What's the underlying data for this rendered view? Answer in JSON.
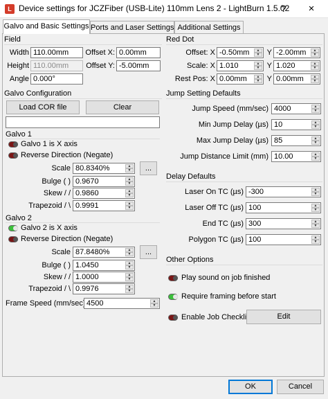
{
  "window": {
    "title": "Device settings for JCZFiber (USB-Lite) 110mm Lens 2 - LightBurn 1.5.02",
    "icon_text": "L",
    "help": "?",
    "close": "×"
  },
  "tabs": [
    "Galvo and Basic Settings",
    "Ports and Laser Settings",
    "Additional Settings"
  ],
  "field": {
    "title": "Field",
    "width_label": "Width",
    "width_value": "110.00mm",
    "height_label": "Height",
    "height_value": "110.00mm",
    "angle_label": "Angle",
    "angle_value": "0.000°",
    "offset_x_label": "Offset X:",
    "offset_x_value": "0.00mm",
    "offset_y_label": "Offset Y:",
    "offset_y_value": "-5.00mm"
  },
  "red_dot": {
    "title": "Red Dot",
    "offset_label": "Offset: X",
    "offset_x": "-0.50mm",
    "offset_y_label": "Y",
    "offset_y": "-2.00mm",
    "scale_label": "Scale: X",
    "scale_x": "1.010",
    "scale_y_label": "Y",
    "scale_y": "1.020",
    "rest_label": "Rest Pos: X",
    "rest_x": "0.00mm",
    "rest_y_label": "Y",
    "rest_y": "0.00mm"
  },
  "galvo_config": {
    "title": "Galvo Configuration",
    "load_cor": "Load COR file",
    "clear": "Clear",
    "cor_path": "",
    "galvo1": {
      "title": "Galvo 1",
      "is_x_axis": "Galvo 1 is X axis",
      "reverse": "Reverse Direction (Negate)",
      "scale_label": "Scale",
      "scale": "80.8340%",
      "bulge_label": "Bulge ( )",
      "bulge": "0.9670",
      "skew_label": "Skew / /",
      "skew": "0.9860",
      "trap_label": "Trapezoid / \\",
      "trap": "0.9991",
      "more": "..."
    },
    "galvo2": {
      "title": "Galvo 2",
      "is_x_axis": "Galvo 2 is X axis",
      "reverse": "Reverse Direction (Negate)",
      "scale_label": "Scale",
      "scale": "87.8480%",
      "bulge_label": "Bulge ( )",
      "bulge": "1.0450",
      "skew_label": "Skew / /",
      "skew": "1.0000",
      "trap_label": "Trapezoid / \\",
      "trap": "0.9976",
      "more": "..."
    },
    "frame_speed_label": "Frame Speed (mm/sec)",
    "frame_speed": "4500"
  },
  "jump": {
    "title": "Jump Setting Defaults",
    "speed_label": "Jump Speed (mm/sec)",
    "speed": "4000",
    "min_label": "Min Jump Delay (µs)",
    "min": "10",
    "max_label": "Max Jump Delay (µs)",
    "max": "85",
    "limit_label": "Jump Distance Limit (mm)",
    "limit": "10.00"
  },
  "delay": {
    "title": "Delay Defaults",
    "on_label": "Laser On TC (µs)",
    "on": "-300",
    "off_label": "Laser Off TC (µs)",
    "off": "100",
    "end_label": "End TC (µs)",
    "end": "300",
    "poly_label": "Polygon TC (µs)",
    "poly": "100"
  },
  "other": {
    "title": "Other Options",
    "play_sound": "Play sound on job finished",
    "require_framing": "Require framing before start",
    "job_checklist": "Enable Job Checklist",
    "edit": "Edit"
  },
  "footer": {
    "ok": "OK",
    "cancel": "Cancel"
  },
  "colors": {
    "toggle_off": "#7a1515",
    "toggle_on": "#3bbf3b",
    "accent": "#0078d7"
  }
}
